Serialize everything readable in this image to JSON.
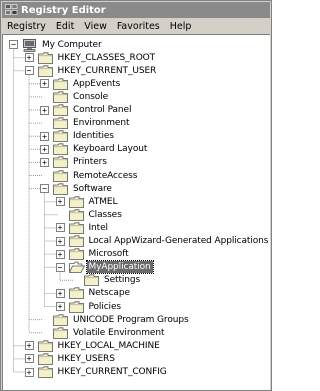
{
  "window": {
    "title": "Registry Editor"
  },
  "menu": [
    {
      "label": "Registry",
      "key": "registry"
    },
    {
      "label": "Edit",
      "key": "edit"
    },
    {
      "label": "View",
      "key": "view"
    },
    {
      "label": "Favorites",
      "key": "favorites"
    },
    {
      "label": "Help",
      "key": "help"
    }
  ],
  "tree": [
    {
      "name": "computer-node-my-computer",
      "label": "My Computer",
      "level": 0,
      "toggle": "-",
      "icon": "computer-icon"
    },
    {
      "name": "tree-node-hkey-classes-root",
      "label": "HKEY_CLASSES_ROOT",
      "level": 1,
      "toggle": "+",
      "icon": "folder-closed-icon"
    },
    {
      "name": "tree-node-hkey-current-user",
      "label": "HKEY_CURRENT_USER",
      "level": 1,
      "toggle": "-",
      "icon": "folder-closed-icon"
    },
    {
      "name": "tree-node-appevents",
      "label": "AppEvents",
      "level": 2,
      "toggle": "+",
      "icon": "folder-closed-icon"
    },
    {
      "name": "tree-node-console",
      "label": "Console",
      "level": 2,
      "toggle": "",
      "icon": "folder-closed-icon"
    },
    {
      "name": "tree-node-control-panel",
      "label": "Control Panel",
      "level": 2,
      "toggle": "+",
      "icon": "folder-closed-icon"
    },
    {
      "name": "tree-node-environment",
      "label": "Environment",
      "level": 2,
      "toggle": "",
      "icon": "folder-closed-icon"
    },
    {
      "name": "tree-node-identities",
      "label": "Identities",
      "level": 2,
      "toggle": "+",
      "icon": "folder-closed-icon"
    },
    {
      "name": "tree-node-keyboard-layout",
      "label": "Keyboard Layout",
      "level": 2,
      "toggle": "+",
      "icon": "folder-closed-icon"
    },
    {
      "name": "tree-node-printers",
      "label": "Printers",
      "level": 2,
      "toggle": "+",
      "icon": "folder-closed-icon"
    },
    {
      "name": "tree-node-remoteaccess",
      "label": "RemoteAccess",
      "level": 2,
      "toggle": "",
      "icon": "folder-closed-icon"
    },
    {
      "name": "tree-node-software",
      "label": "Software",
      "level": 2,
      "toggle": "-",
      "icon": "folder-closed-icon"
    },
    {
      "name": "tree-node-atmel",
      "label": "ATMEL",
      "level": 3,
      "toggle": "+",
      "icon": "folder-closed-icon"
    },
    {
      "name": "tree-node-classes",
      "label": "Classes",
      "level": 3,
      "toggle": "",
      "icon": "folder-closed-icon"
    },
    {
      "name": "tree-node-intel",
      "label": "Intel",
      "level": 3,
      "toggle": "+",
      "icon": "folder-closed-icon"
    },
    {
      "name": "tree-node-local-appwizard",
      "label": "Local AppWizard-Generated Applications",
      "level": 3,
      "toggle": "+",
      "icon": "folder-closed-icon"
    },
    {
      "name": "tree-node-microsoft",
      "label": "Microsoft",
      "level": 3,
      "toggle": "+",
      "icon": "folder-closed-icon"
    },
    {
      "name": "tree-node-myapplication",
      "label": "MyApplication",
      "level": 3,
      "toggle": "-",
      "icon": "folder-open-icon",
      "selected": true
    },
    {
      "name": "tree-node-settings",
      "label": "Settings",
      "level": 4,
      "toggle": "",
      "icon": "folder-closed-icon"
    },
    {
      "name": "tree-node-netscape",
      "label": "Netscape",
      "level": 3,
      "toggle": "+",
      "icon": "folder-closed-icon"
    },
    {
      "name": "tree-node-policies",
      "label": "Policies",
      "level": 3,
      "toggle": "+",
      "icon": "folder-closed-icon"
    },
    {
      "name": "tree-node-unicode-program-groups",
      "label": "UNICODE Program Groups",
      "level": 2,
      "toggle": "",
      "icon": "folder-closed-icon"
    },
    {
      "name": "tree-node-volatile-environment",
      "label": "Volatile Environment",
      "level": 2,
      "toggle": "",
      "icon": "folder-closed-icon"
    },
    {
      "name": "tree-node-hkey-local-machine",
      "label": "HKEY_LOCAL_MACHINE",
      "level": 1,
      "toggle": "+",
      "icon": "folder-closed-icon"
    },
    {
      "name": "tree-node-hkey-users",
      "label": "HKEY_USERS",
      "level": 1,
      "toggle": "+",
      "icon": "folder-closed-icon"
    },
    {
      "name": "tree-node-hkey-current-config",
      "label": "HKEY_CURRENT_CONFIG",
      "level": 1,
      "toggle": "+",
      "icon": "folder-closed-icon"
    }
  ]
}
